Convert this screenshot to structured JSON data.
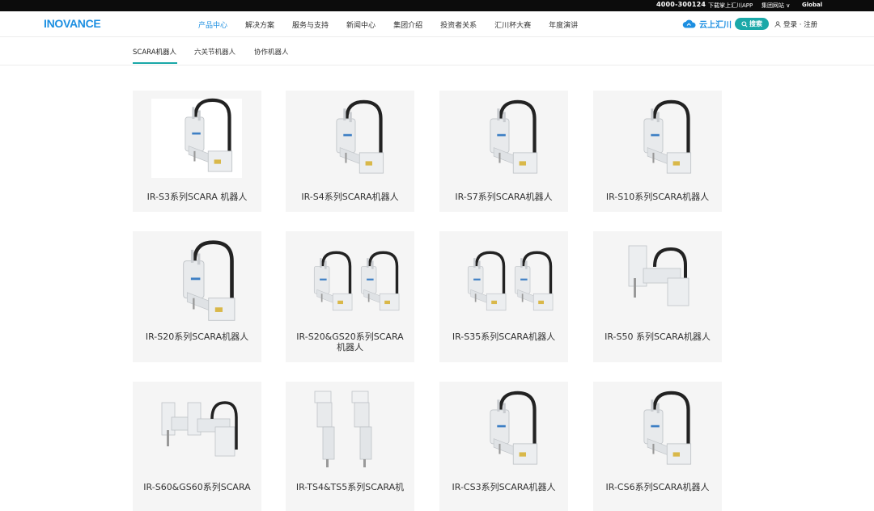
{
  "topbar": {
    "phone": "4000-300124",
    "app": "下载掌上汇川APP",
    "group": "集团网站 ∨",
    "global": "Global"
  },
  "nav": {
    "logo": "INOVANCE",
    "menu": [
      "产品中心",
      "解决方案",
      "服务与支持",
      "新闻中心",
      "集团介绍",
      "投资者关系",
      "汇川杯大赛",
      "年度演讲"
    ],
    "active_menu": "产品中心",
    "cloud_label": "云上汇川",
    "search_label": "搜索",
    "login_label": "登录 · 注册"
  },
  "subtabs": {
    "items": [
      "SCARA机器人",
      "六关节机器人",
      "协作机器人"
    ],
    "active": "SCARA机器人"
  },
  "products": [
    {
      "name": "IR-S3系列SCARA 机器人",
      "variant": "single-photo"
    },
    {
      "name": "IR-S4系列SCARA机器人",
      "variant": "single"
    },
    {
      "name": "IR-S7系列SCARA机器人",
      "variant": "single"
    },
    {
      "name": "IR-S10系列SCARA机器人",
      "variant": "single"
    },
    {
      "name": "IR-S20系列SCARA机器人",
      "variant": "single-tall"
    },
    {
      "name": "IR-S20&GS20系列SCARA 机器人",
      "variant": "double"
    },
    {
      "name": "IR-S35系列SCARA机器人",
      "variant": "double"
    },
    {
      "name": "IR-S50 系列SCARA机器人",
      "variant": "single-box"
    },
    {
      "name": "IR-S60&GS60系列SCARA",
      "variant": "double-box"
    },
    {
      "name": "IR-TS4&TS5系列SCARA机",
      "variant": "double-inverted"
    },
    {
      "name": "IR-CS3系列SCARA机器人",
      "variant": "single"
    },
    {
      "name": "IR-CS6系列SCARA机器人",
      "variant": "single"
    }
  ],
  "colors": {
    "brand_blue": "#1d8fe1",
    "teal": "#1aa8a8",
    "card_bg": "#f5f5f5",
    "topbar_bg": "#0c0c0c"
  }
}
